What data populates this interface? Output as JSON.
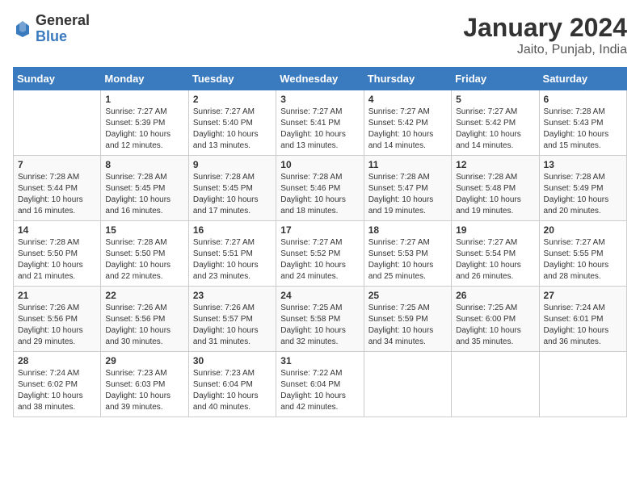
{
  "logo": {
    "general": "General",
    "blue": "Blue"
  },
  "header": {
    "title": "January 2024",
    "subtitle": "Jaito, Punjab, India"
  },
  "columns": [
    "Sunday",
    "Monday",
    "Tuesday",
    "Wednesday",
    "Thursday",
    "Friday",
    "Saturday"
  ],
  "weeks": [
    [
      {
        "day": "",
        "info": ""
      },
      {
        "day": "1",
        "info": "Sunrise: 7:27 AM\nSunset: 5:39 PM\nDaylight: 10 hours\nand 12 minutes."
      },
      {
        "day": "2",
        "info": "Sunrise: 7:27 AM\nSunset: 5:40 PM\nDaylight: 10 hours\nand 13 minutes."
      },
      {
        "day": "3",
        "info": "Sunrise: 7:27 AM\nSunset: 5:41 PM\nDaylight: 10 hours\nand 13 minutes."
      },
      {
        "day": "4",
        "info": "Sunrise: 7:27 AM\nSunset: 5:42 PM\nDaylight: 10 hours\nand 14 minutes."
      },
      {
        "day": "5",
        "info": "Sunrise: 7:27 AM\nSunset: 5:42 PM\nDaylight: 10 hours\nand 14 minutes."
      },
      {
        "day": "6",
        "info": "Sunrise: 7:28 AM\nSunset: 5:43 PM\nDaylight: 10 hours\nand 15 minutes."
      }
    ],
    [
      {
        "day": "7",
        "info": "Sunrise: 7:28 AM\nSunset: 5:44 PM\nDaylight: 10 hours\nand 16 minutes."
      },
      {
        "day": "8",
        "info": "Sunrise: 7:28 AM\nSunset: 5:45 PM\nDaylight: 10 hours\nand 16 minutes."
      },
      {
        "day": "9",
        "info": "Sunrise: 7:28 AM\nSunset: 5:45 PM\nDaylight: 10 hours\nand 17 minutes."
      },
      {
        "day": "10",
        "info": "Sunrise: 7:28 AM\nSunset: 5:46 PM\nDaylight: 10 hours\nand 18 minutes."
      },
      {
        "day": "11",
        "info": "Sunrise: 7:28 AM\nSunset: 5:47 PM\nDaylight: 10 hours\nand 19 minutes."
      },
      {
        "day": "12",
        "info": "Sunrise: 7:28 AM\nSunset: 5:48 PM\nDaylight: 10 hours\nand 19 minutes."
      },
      {
        "day": "13",
        "info": "Sunrise: 7:28 AM\nSunset: 5:49 PM\nDaylight: 10 hours\nand 20 minutes."
      }
    ],
    [
      {
        "day": "14",
        "info": "Sunrise: 7:28 AM\nSunset: 5:50 PM\nDaylight: 10 hours\nand 21 minutes."
      },
      {
        "day": "15",
        "info": "Sunrise: 7:28 AM\nSunset: 5:50 PM\nDaylight: 10 hours\nand 22 minutes."
      },
      {
        "day": "16",
        "info": "Sunrise: 7:27 AM\nSunset: 5:51 PM\nDaylight: 10 hours\nand 23 minutes."
      },
      {
        "day": "17",
        "info": "Sunrise: 7:27 AM\nSunset: 5:52 PM\nDaylight: 10 hours\nand 24 minutes."
      },
      {
        "day": "18",
        "info": "Sunrise: 7:27 AM\nSunset: 5:53 PM\nDaylight: 10 hours\nand 25 minutes."
      },
      {
        "day": "19",
        "info": "Sunrise: 7:27 AM\nSunset: 5:54 PM\nDaylight: 10 hours\nand 26 minutes."
      },
      {
        "day": "20",
        "info": "Sunrise: 7:27 AM\nSunset: 5:55 PM\nDaylight: 10 hours\nand 28 minutes."
      }
    ],
    [
      {
        "day": "21",
        "info": "Sunrise: 7:26 AM\nSunset: 5:56 PM\nDaylight: 10 hours\nand 29 minutes."
      },
      {
        "day": "22",
        "info": "Sunrise: 7:26 AM\nSunset: 5:56 PM\nDaylight: 10 hours\nand 30 minutes."
      },
      {
        "day": "23",
        "info": "Sunrise: 7:26 AM\nSunset: 5:57 PM\nDaylight: 10 hours\nand 31 minutes."
      },
      {
        "day": "24",
        "info": "Sunrise: 7:25 AM\nSunset: 5:58 PM\nDaylight: 10 hours\nand 32 minutes."
      },
      {
        "day": "25",
        "info": "Sunrise: 7:25 AM\nSunset: 5:59 PM\nDaylight: 10 hours\nand 34 minutes."
      },
      {
        "day": "26",
        "info": "Sunrise: 7:25 AM\nSunset: 6:00 PM\nDaylight: 10 hours\nand 35 minutes."
      },
      {
        "day": "27",
        "info": "Sunrise: 7:24 AM\nSunset: 6:01 PM\nDaylight: 10 hours\nand 36 minutes."
      }
    ],
    [
      {
        "day": "28",
        "info": "Sunrise: 7:24 AM\nSunset: 6:02 PM\nDaylight: 10 hours\nand 38 minutes."
      },
      {
        "day": "29",
        "info": "Sunrise: 7:23 AM\nSunset: 6:03 PM\nDaylight: 10 hours\nand 39 minutes."
      },
      {
        "day": "30",
        "info": "Sunrise: 7:23 AM\nSunset: 6:04 PM\nDaylight: 10 hours\nand 40 minutes."
      },
      {
        "day": "31",
        "info": "Sunrise: 7:22 AM\nSunset: 6:04 PM\nDaylight: 10 hours\nand 42 minutes."
      },
      {
        "day": "",
        "info": ""
      },
      {
        "day": "",
        "info": ""
      },
      {
        "day": "",
        "info": ""
      }
    ]
  ]
}
